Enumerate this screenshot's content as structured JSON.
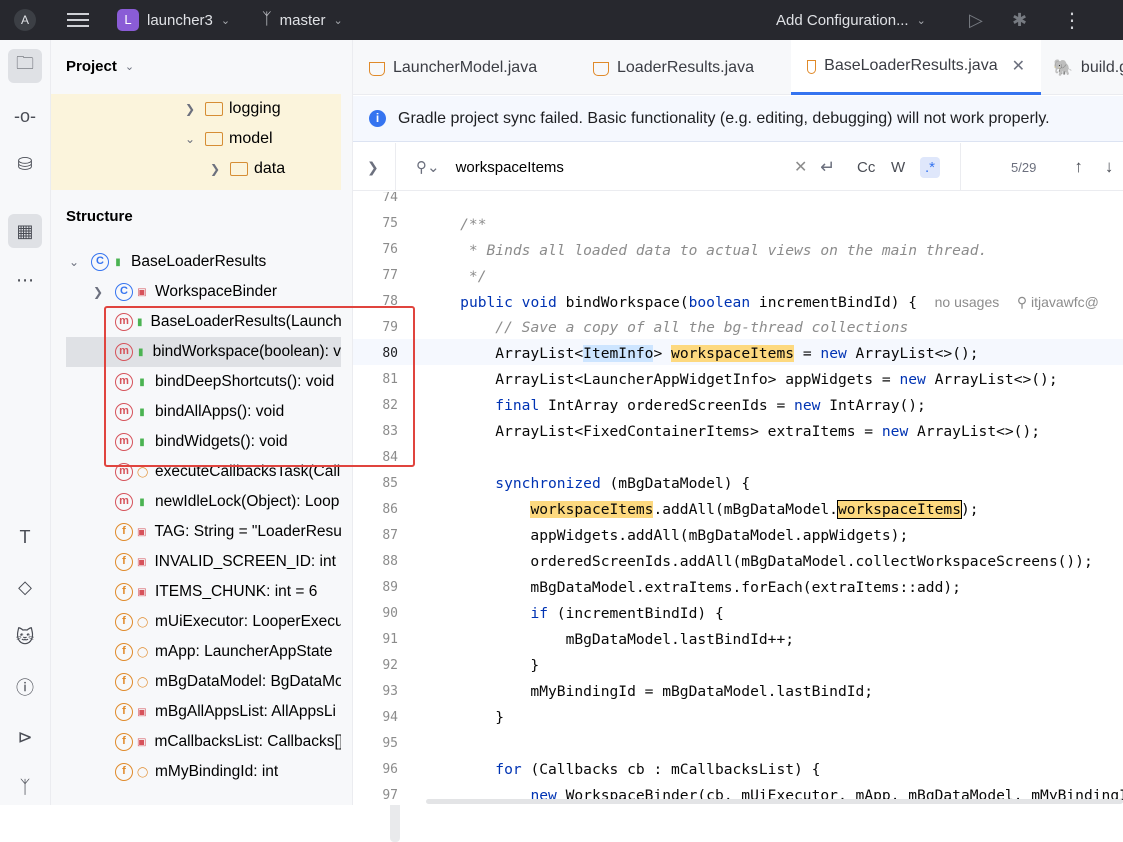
{
  "topbar": {
    "project_badge": "L",
    "project_name": "launcher3",
    "branch": "master",
    "add_config": "Add Configuration..."
  },
  "project_panel": {
    "title": "Project",
    "tree": [
      {
        "label": "logging"
      },
      {
        "label": "model"
      },
      {
        "label": "data"
      }
    ]
  },
  "structure": {
    "title": "Structure",
    "items": [
      {
        "label": "BaseLoaderResults",
        "icon": "class-icon"
      },
      {
        "label": "WorkspaceBinder",
        "icon": "inner-class-icon"
      },
      {
        "label": "BaseLoaderResults(Launch",
        "icon": "method-icon"
      },
      {
        "label": "bindWorkspace(boolean): v",
        "icon": "method-icon"
      },
      {
        "label": "bindDeepShortcuts(): void",
        "icon": "method-icon"
      },
      {
        "label": "bindAllApps(): void",
        "icon": "method-icon"
      },
      {
        "label": "bindWidgets(): void",
        "icon": "method-icon"
      },
      {
        "label": "executeCallbacksTask(Callb",
        "icon": "method-icon"
      },
      {
        "label": "newIdleLock(Object): Loop",
        "icon": "method-icon"
      },
      {
        "label": "TAG: String = \"LoaderResu",
        "icon": "constant-icon"
      },
      {
        "label": "INVALID_SCREEN_ID: int =",
        "icon": "constant-icon"
      },
      {
        "label": "ITEMS_CHUNK: int = 6",
        "icon": "constant-icon"
      },
      {
        "label": "mUiExecutor: LooperExecu",
        "icon": "field-icon"
      },
      {
        "label": "mApp: LauncherAppState",
        "icon": "field-icon"
      },
      {
        "label": "mBgDataModel: BgDataMo",
        "icon": "field-icon"
      },
      {
        "label": "mBgAllAppsList: AllAppsLi",
        "icon": "field-icon"
      },
      {
        "label": "mCallbacksList: Callbacks[]",
        "icon": "field-icon"
      },
      {
        "label": "mMyBindingId: int",
        "icon": "field-icon"
      }
    ]
  },
  "tabs": [
    {
      "label": "LauncherModel.java"
    },
    {
      "label": "LoaderResults.java"
    },
    {
      "label": "BaseLoaderResults.java"
    },
    {
      "label": "build.g"
    }
  ],
  "notice": "Gradle project sync failed. Basic functionality (e.g. editing, debugging) will not work properly.",
  "find": {
    "query": "workspaceItems",
    "cc": "Cc",
    "w": "W",
    "regex": ".*",
    "count": "5/29"
  },
  "editor": {
    "line_numbers": [
      "74",
      "75",
      "76",
      "77",
      "78",
      "79",
      "80",
      "81",
      "82",
      "83",
      "84",
      "85",
      "86",
      "87",
      "88",
      "89",
      "90",
      "91",
      "92",
      "93",
      "94",
      "95",
      "96",
      "97"
    ],
    "hints": {
      "usages": "no usages",
      "author": "itjavawfc@"
    }
  }
}
